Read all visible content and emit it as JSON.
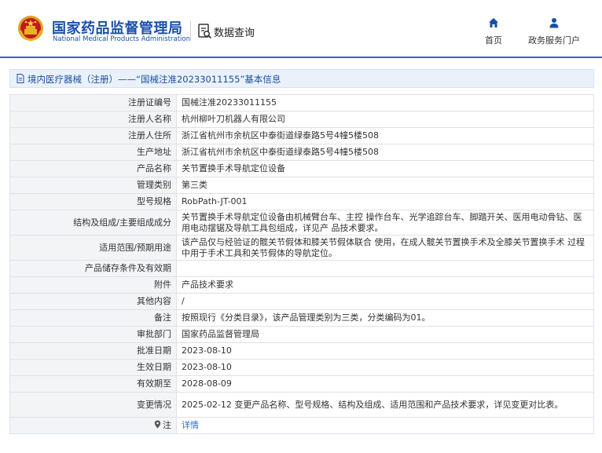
{
  "header": {
    "org_cn": "国家药品监督管理局",
    "org_en": "National Medical Products Administration",
    "query_title": "数据查询",
    "nav": {
      "home_label": "首页",
      "portal_label": "政务服务门户"
    }
  },
  "breadcrumb": {
    "text": "境内医疗器械（注册）——“国械注准20233011155”基本信息"
  },
  "colors": {
    "brand_blue": "#1b4fa8",
    "accent_blue": "#2c6ad3",
    "label_bg": "#f3f4f6"
  },
  "records": [
    {
      "label": "注册证编号",
      "value": "国械注准20233011155"
    },
    {
      "label": "注册人名称",
      "value": "杭州柳叶刀机器人有限公司"
    },
    {
      "label": "注册人住所",
      "value": "浙江省杭州市余杭区中泰街道绿泰路5号4幢5楼508"
    },
    {
      "label": "生产地址",
      "value": "浙江省杭州市余杭区中泰街道绿泰路5号4幢5楼508"
    },
    {
      "label": "产品名称",
      "value": "关节置换手术导航定位设备"
    },
    {
      "label": "管理类别",
      "value": "第三类"
    },
    {
      "label": "型号规格",
      "value": "RobPath-JT-001"
    },
    {
      "label": "结构及组成/主要组成成分",
      "value": "关节置换手术导航定位设备由机械臂台车、主控 操作台车、光学追踪台车、脚踏开关、医用电动骨钻、医用电动摆锯及导航工具包组成，详见产 品技术要求。"
    },
    {
      "label": "适用范围/预期用途",
      "value": "该产品仅与经验证的髋关节假体和膝关节假体联合 使用，在成人髋关节置换手术及全膝关节置换手术 过程中用于手术工具和关节假体的导航定位。"
    },
    {
      "label": "产品储存条件及有效期",
      "value": ""
    },
    {
      "label": "附件",
      "value": "产品技术要求"
    },
    {
      "label": "其他内容",
      "value": "/"
    },
    {
      "label": "备注",
      "value": "按照现行《分类目录》，该产品管理类别为三类，分类编码为01。"
    },
    {
      "label": "审批部门",
      "value": "国家药品监督管理局"
    },
    {
      "label": "批准日期",
      "value": "2023-08-10"
    },
    {
      "label": "生效日期",
      "value": "2023-08-10"
    },
    {
      "label": "有效期至",
      "value": "2028-08-09"
    },
    {
      "label": "变更情况",
      "value": "2025-02-12 变更产品名称、型号规格、结构及组成、适用范围和产品技术要求，详见变更对比表。"
    }
  ],
  "note": {
    "label": "注",
    "link_text": "详情"
  }
}
